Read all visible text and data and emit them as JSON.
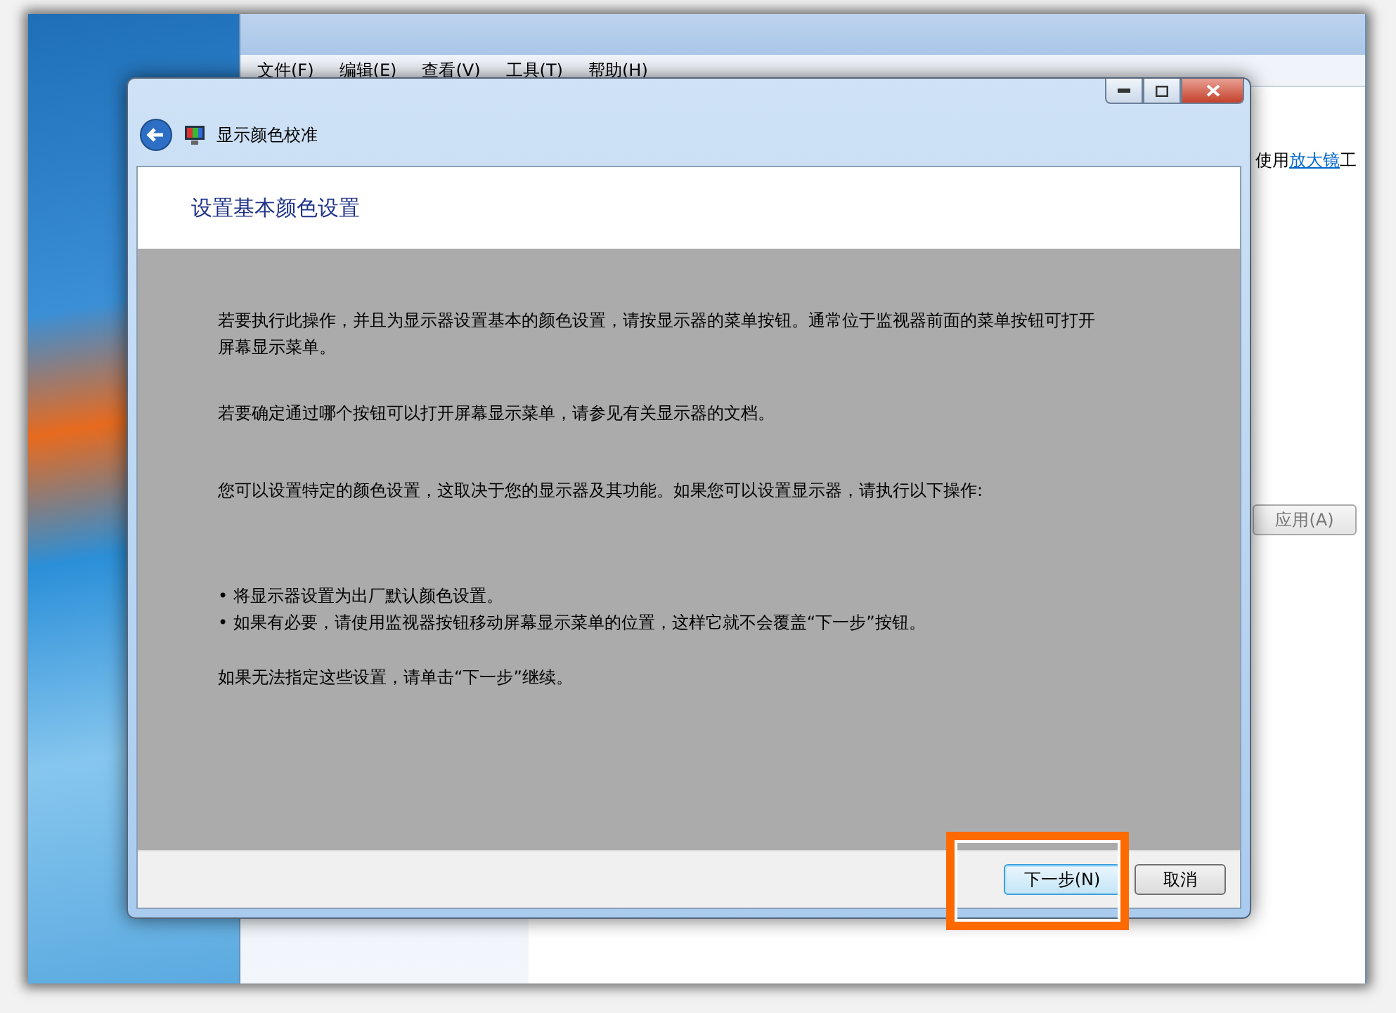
{
  "background_window": {
    "menu": [
      {
        "label": "文件(F)"
      },
      {
        "label": "编辑(E)"
      },
      {
        "label": "查看(V)"
      },
      {
        "label": "工具(T)"
      },
      {
        "label": "帮助(H)"
      }
    ],
    "body_text": {
      "prefix": "使用",
      "link": "放大镜",
      "suffix": "工"
    },
    "apply_button": "应用(A)"
  },
  "dialog": {
    "title": "显示颜色校准",
    "heading": "设置基本颜色设置",
    "paragraphs": [
      "若要执行此操作，并且为显示器设置基本的颜色设置，请按显示器的菜单按钮。通常位于监视器前面的菜单按钮可打开屏幕显示菜单。",
      "若要确定通过哪个按钮可以打开屏幕显示菜单，请参见有关显示器的文档。",
      "您可以设置特定的颜色设置，这取决于您的显示器及其功能。如果您可以设置显示器，请执行以下操作:"
    ],
    "bullets": [
      {
        "marker": "•",
        "text": "将显示器设置为出厂默认颜色设置。"
      },
      {
        "marker": "•",
        "text": "如果有必要，请使用监视器按钮移动屏幕显示菜单的位置，这样它就不会覆盖“下一步”按钮。"
      }
    ],
    "closing": "如果无法指定这些设置，请单击“下一步”继续。",
    "buttons": [
      {
        "label": "下一步(N)",
        "focused": true
      },
      {
        "label": "取消",
        "focused": false
      }
    ]
  }
}
